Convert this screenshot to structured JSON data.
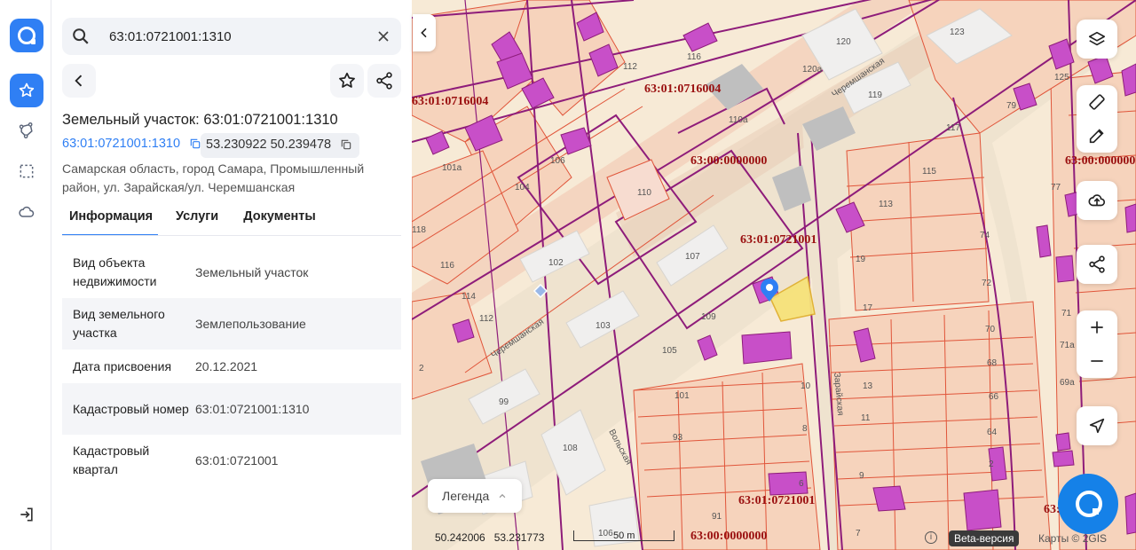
{
  "search": {
    "value": "63:01:0721001:1310"
  },
  "object": {
    "title": "Земельный участок: 63:01:0721001:1310",
    "cadastral_link": "63:01:0721001:1310",
    "coords": "53.230922 50.239478",
    "address": "Самарская область, город Самара, Промышленный район, ул. Зарайская/ул. Черемшанская"
  },
  "tabs": [
    {
      "label": "Информация",
      "active": true
    },
    {
      "label": "Услуги",
      "active": false
    },
    {
      "label": "Документы",
      "active": false
    }
  ],
  "info_rows": [
    {
      "key": "Вид объекта недвижимости",
      "value": "Земельный участок"
    },
    {
      "key": "Вид земельного участка",
      "value": "Землепользование"
    },
    {
      "key": "Дата присвоения",
      "value": "20.12.2021"
    },
    {
      "key": "Кадастровый номер",
      "value": "63:01:0721001:1310"
    },
    {
      "key": "Кадастровый квартал",
      "value": "63:01:0721001"
    }
  ],
  "map": {
    "cadastral_labels": [
      "63:01:0716004",
      "63:01:0716004",
      "63:00:0000000",
      "63:00:0000000",
      "63:01:0721001",
      "63:01:0721001",
      "63:00:0000000",
      "63:0"
    ],
    "streets": [
      "Черемшанская",
      "Черемшанская",
      "Зарайская",
      "Вольская"
    ],
    "buildings": [
      "120",
      "123",
      "120а",
      "119",
      "110а",
      "117",
      "115",
      "110",
      "113",
      "102",
      "107",
      "103",
      "109",
      "99",
      "108",
      "101",
      "93",
      "106",
      "91",
      "112",
      "116",
      "106",
      "104",
      "101а",
      "114",
      "112",
      "118",
      "116",
      "2",
      "105",
      "10",
      "8",
      "6",
      "9",
      "7",
      "13",
      "11",
      "17",
      "19",
      "72",
      "74",
      "70",
      "68",
      "66",
      "64",
      "71",
      "71а",
      "69а",
      "77",
      "79",
      "125",
      "2"
    ],
    "legend": "Легенда",
    "cursor_coords": "50.242006   53.231773",
    "scale_label": "50 m",
    "beta": "Beta-версия",
    "attribution": "Карты © 2GIS"
  },
  "colors": {
    "accent": "#2f7ff4",
    "parcel_line": "#e0553a",
    "boundary": "#8e1c7a",
    "building": "#c84fc8",
    "selected": "#f6e27a"
  }
}
